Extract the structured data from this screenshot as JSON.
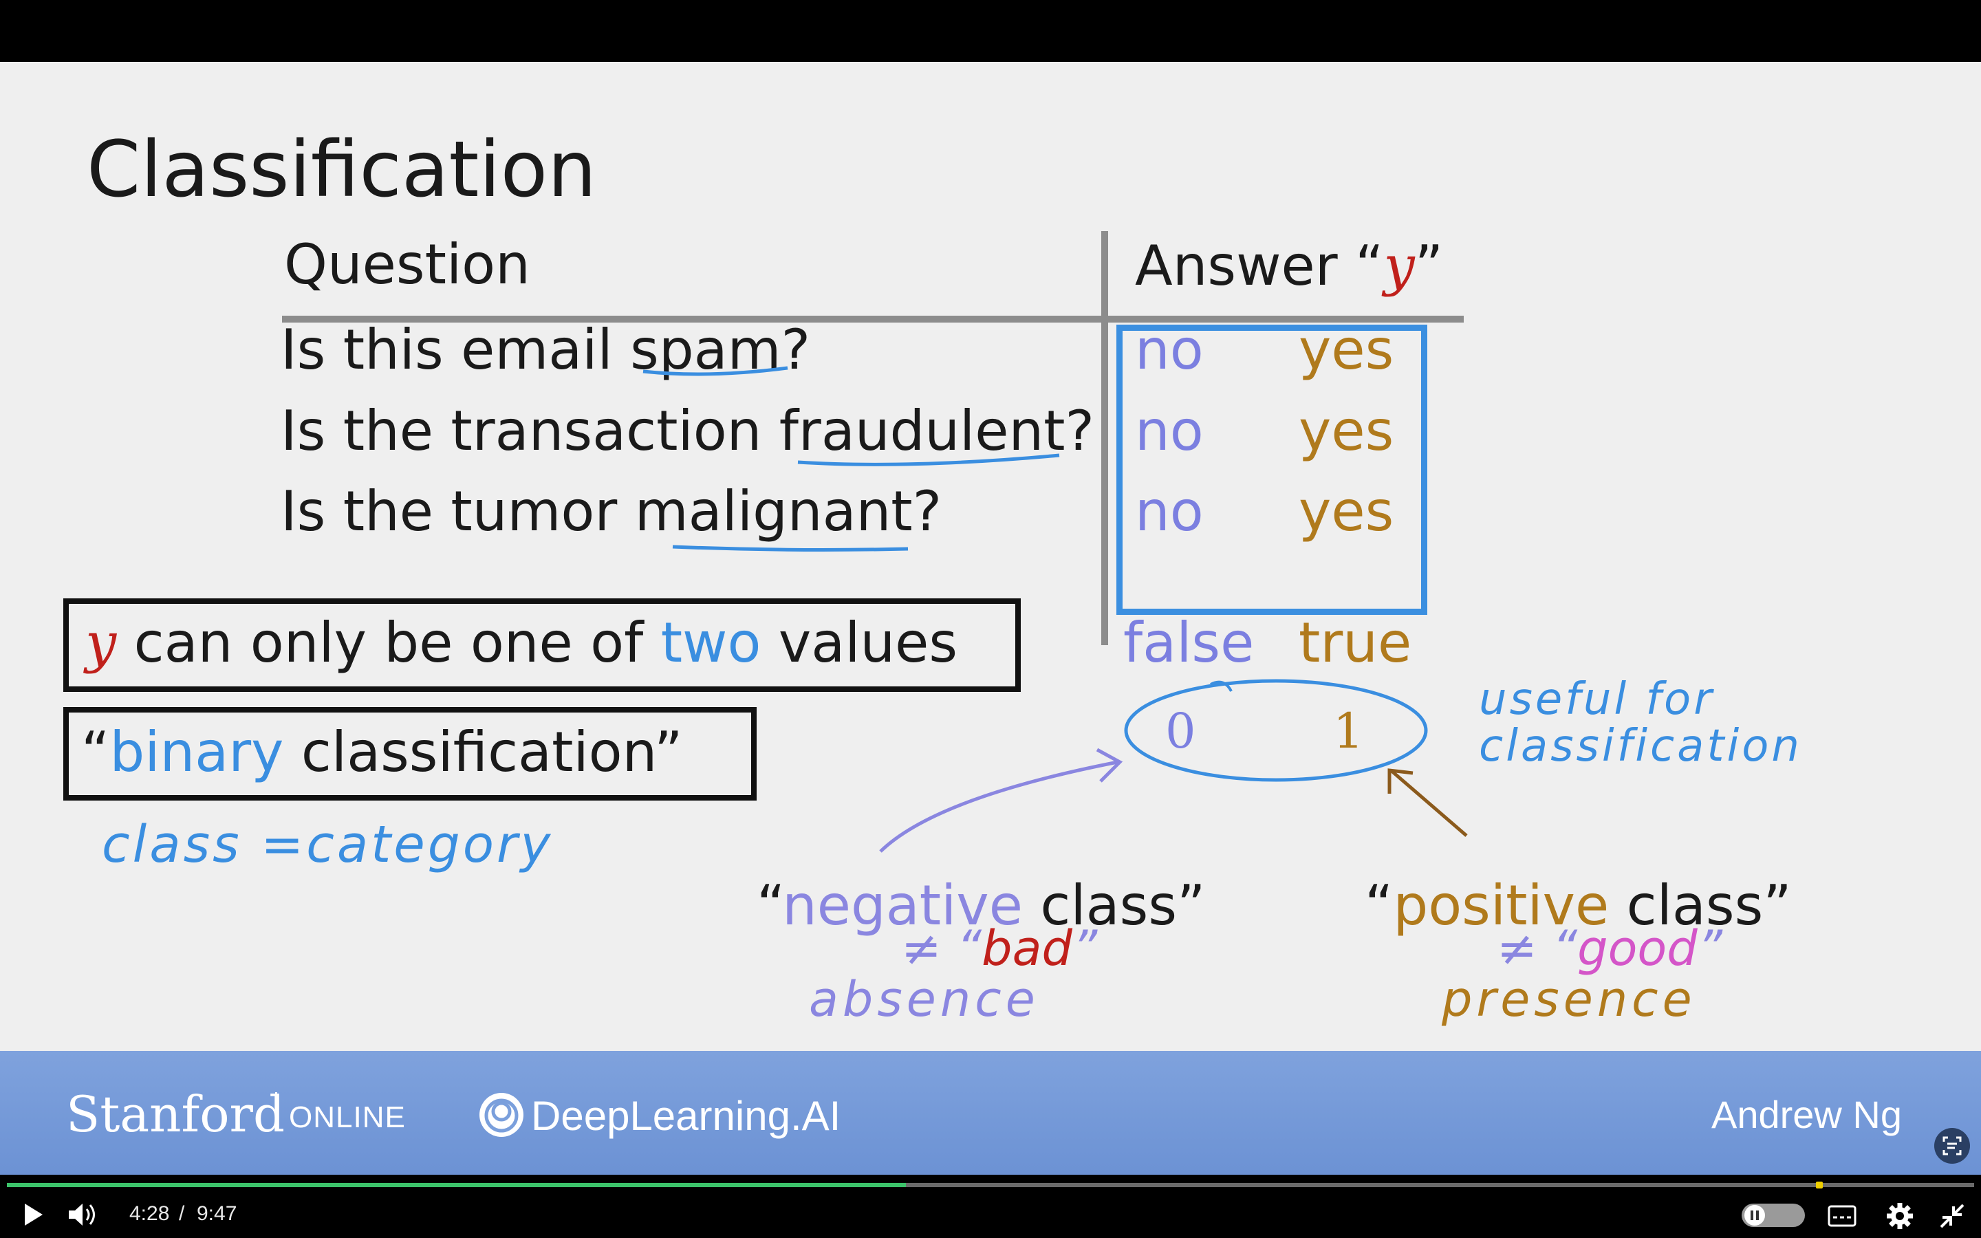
{
  "slide": {
    "title": "Classification",
    "table": {
      "header_question": "Question",
      "header_answer_prefix": "Answer “",
      "header_answer_var": "y",
      "header_answer_suffix": "”",
      "rows": [
        {
          "q_pre": "Is this email ",
          "q_key": "spam",
          "q_post": "?",
          "no": "no",
          "yes": "yes"
        },
        {
          "q_pre": "Is the transaction ",
          "q_key": "fraudulent",
          "q_post": "?",
          "no": "no",
          "yes": "yes"
        },
        {
          "q_pre": "Is the tumor ",
          "q_key": "malignant",
          "q_post": "?",
          "no": "no",
          "yes": "yes"
        }
      ]
    },
    "box1": {
      "var": "y",
      "pre": " can only be one of ",
      "two": "two",
      "post": " values"
    },
    "box2": {
      "open": "“",
      "binary": "binary",
      "rest": " classification”"
    },
    "class_eq": "class =category",
    "false_label": "false",
    "true_label": "true",
    "zero": "0",
    "one": "1",
    "useful_line1": "useful for",
    "useful_line2": "classification",
    "negative": {
      "open": "“",
      "word": "negative",
      "rest": " class”"
    },
    "positive": {
      "open": "“",
      "word": "positive",
      "rest": " class”"
    },
    "neq_bad_pre": "≠ “",
    "bad": "bad",
    "neq_bad_post": "”",
    "neq_good_pre": "≠ “",
    "good": "good",
    "neq_good_post": "”",
    "absence": "absence",
    "presence": "presence"
  },
  "footer": {
    "stanford": "Stanford",
    "online": "ONLINE",
    "deeplearning": "DeepLearning.AI",
    "presenter": "Andrew Ng"
  },
  "player": {
    "current_time": "4:28",
    "separator": "/",
    "duration": "9:47",
    "progress": 0.457,
    "icons": [
      "play-icon",
      "volume-icon",
      "pause-toggle-icon",
      "captions-icon",
      "settings-icon",
      "exit-fullscreen-icon",
      "screen-capture-icon"
    ]
  },
  "colors": {
    "no": "#7b7fe0",
    "yes": "#b07a1c",
    "blue_box": "#3b8fe0",
    "red_var": "#c0201b",
    "handwriting_blue": "#3a8ee0",
    "purple": "#8a86e0",
    "footer": "#7a9fdc",
    "progress": "#3cc36a"
  }
}
